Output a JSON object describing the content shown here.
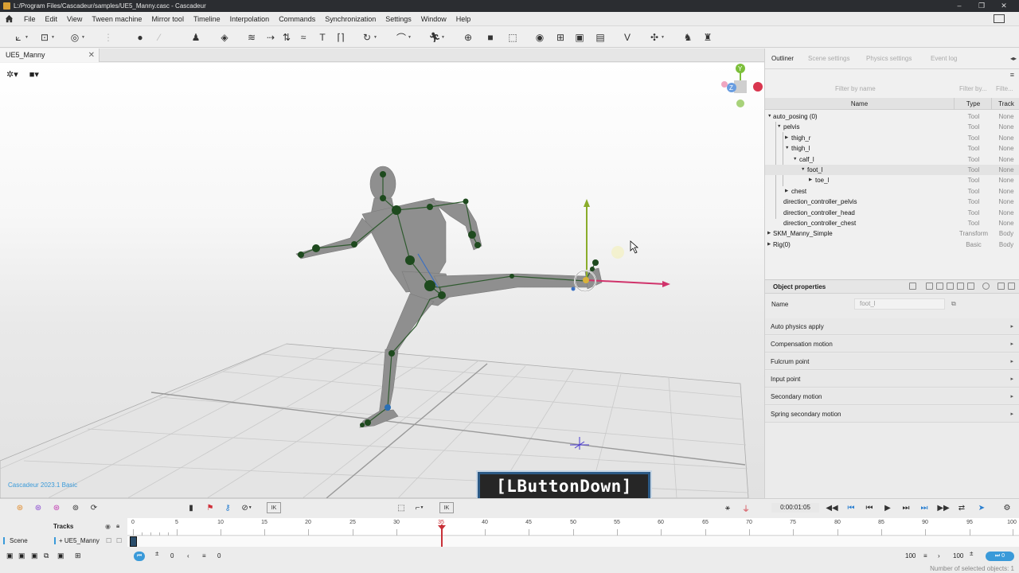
{
  "window": {
    "title": "L:/Program Files/Cascadeur/samples/UE5_Manny.casc - Cascadeur",
    "controls": [
      "–",
      "❐",
      "✕"
    ]
  },
  "menu": [
    "File",
    "Edit",
    "View",
    "Tween machine",
    "Mirror tool",
    "Timeline",
    "Interpolation",
    "Commands",
    "Synchronization",
    "Settings",
    "Window",
    "Help"
  ],
  "document_tab": {
    "label": "UE5_Manny",
    "close": "✕"
  },
  "viewport": {
    "version_label": "Cascadeur 2023.1 Basic",
    "overlay_text": "[LButtonDown]",
    "gizmo_axes": {
      "y": "Y",
      "z": "Z"
    }
  },
  "right_panel": {
    "tabs": [
      "Outliner",
      "Scene settings",
      "Physics settings",
      "Event log"
    ],
    "menu_icon": "≡",
    "filter_name": "Filter by name",
    "filter_type": "Filter by...",
    "filter_track": "Filte...",
    "columns": {
      "name": "Name",
      "type": "Type",
      "track": "Track"
    },
    "tree": [
      {
        "name": "auto_posing (0)",
        "type": "Tool",
        "track": "None"
      },
      {
        "name": "pelvis",
        "type": "Tool",
        "track": "None"
      },
      {
        "name": "thigh_r",
        "type": "Tool",
        "track": "None"
      },
      {
        "name": "thigh_l",
        "type": "Tool",
        "track": "None"
      },
      {
        "name": "calf_l",
        "type": "Tool",
        "track": "None"
      },
      {
        "name": "foot_l",
        "type": "Tool",
        "track": "None"
      },
      {
        "name": "toe_l",
        "type": "Tool",
        "track": "None"
      },
      {
        "name": "chest",
        "type": "Tool",
        "track": "None"
      },
      {
        "name": "direction_controller_pelvis",
        "type": "Tool",
        "track": "None"
      },
      {
        "name": "direction_controller_head",
        "type": "Tool",
        "track": "None"
      },
      {
        "name": "direction_controller_chest",
        "type": "Tool",
        "track": "None"
      },
      {
        "name": "SKM_Manny_Simple",
        "type": "Transform",
        "track": "Body"
      },
      {
        "name": "Rig(0)",
        "type": "Basic",
        "track": "Body"
      }
    ]
  },
  "object_properties": {
    "title": "Object properties",
    "name_label": "Name",
    "name_value": "foot_l",
    "sections": [
      "Auto physics apply",
      "Compensation motion",
      "Fulcrum point",
      "Input point",
      "Secondary motion",
      "Spring secondary motion"
    ]
  },
  "timeline": {
    "time": "0:00:01:05",
    "tracks_label": "Tracks",
    "scene_label": "Scene",
    "object_track": "+ UE5_Manny",
    "ruler_ticks": [
      "0",
      "5",
      "10",
      "15",
      "20",
      "25",
      "30",
      "35",
      "40",
      "45",
      "50",
      "55",
      "60",
      "65",
      "70",
      "75",
      "80",
      "85",
      "90",
      "95",
      "100"
    ],
    "current_frame": "35",
    "start_field": "0",
    "offset_field": "0",
    "end_field": "100",
    "end_field2": "100",
    "ik_label": "IK",
    "selected_count_label": "Number of selected objects: 1"
  }
}
